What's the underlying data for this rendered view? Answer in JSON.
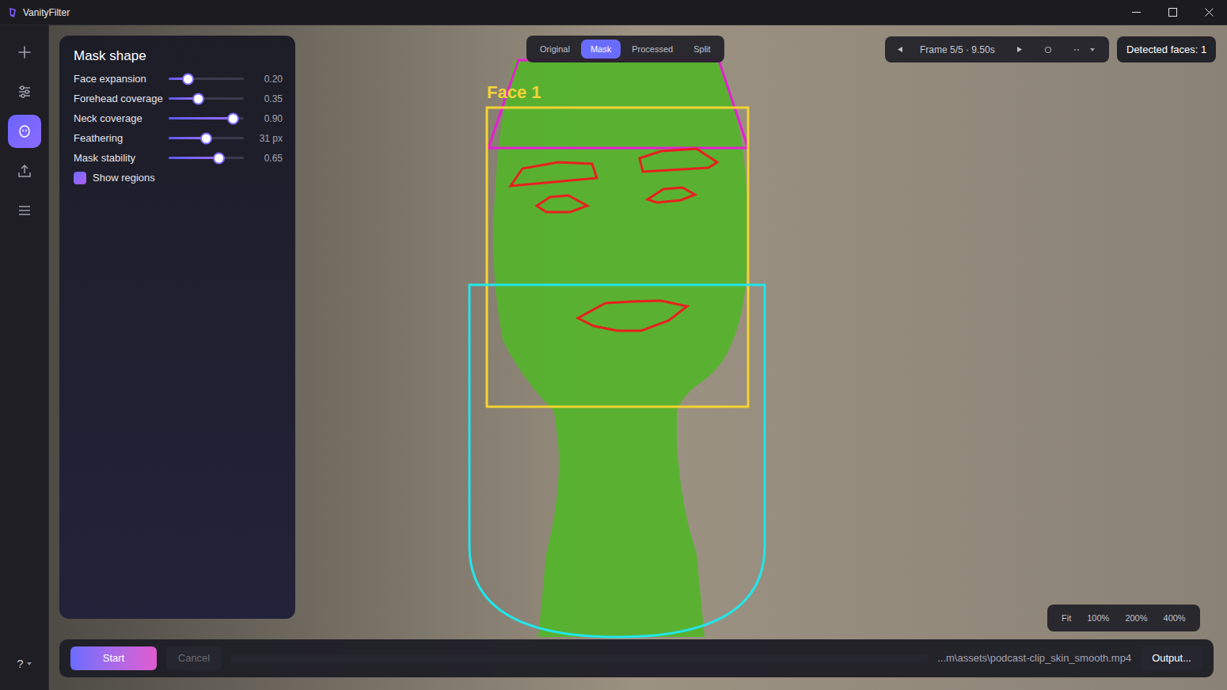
{
  "window": {
    "title": "VanityFilter"
  },
  "rail": {
    "items": [
      {
        "selected": false
      },
      {
        "selected": false
      },
      {
        "selected": true
      },
      {
        "selected": false
      },
      {
        "selected": false
      }
    ],
    "help": "?"
  },
  "panel": {
    "title": "Mask shape",
    "sliders": [
      {
        "label": "Face expansion",
        "level": 0.25,
        "reading": "0.20"
      },
      {
        "label": "Forehead coverage",
        "level": 0.39,
        "reading": "0.35"
      },
      {
        "label": "Neck coverage",
        "level": 0.85,
        "reading": "0.90"
      },
      {
        "label": "Feathering",
        "level": 0.49,
        "reading": "31 px"
      },
      {
        "label": "Mask stability",
        "level": 0.66,
        "reading": "0.65"
      }
    ],
    "show_regions": {
      "label": "Show regions",
      "checked": true
    }
  },
  "view_tabs": [
    {
      "label": "Original",
      "selected": false
    },
    {
      "label": "Mask",
      "selected": true
    },
    {
      "label": "Processed",
      "selected": false
    },
    {
      "label": "Split",
      "selected": false
    }
  ],
  "frame_nav": {
    "label": "Frame 5/5 · 9.50s"
  },
  "detected_faces": "Detected faces: 1",
  "overlay": {
    "faces": [
      {
        "label": "Face 1"
      }
    ],
    "regions": [
      {
        "kind": "forehead",
        "color": "#e61fd4"
      },
      {
        "kind": "face",
        "color": "#f5d332"
      },
      {
        "kind": "neck",
        "color": "#22e6ea"
      },
      {
        "kind": "brow-left",
        "color": "#e8201e"
      },
      {
        "kind": "brow-right",
        "color": "#e8201e"
      },
      {
        "kind": "eye-left",
        "color": "#e8201e"
      },
      {
        "kind": "eye-right",
        "color": "#e8201e"
      },
      {
        "kind": "lips",
        "color": "#e8201e"
      }
    ]
  },
  "zoom": [
    {
      "label": "Fit",
      "selected": false
    },
    {
      "label": "100%",
      "selected": false
    },
    {
      "label": "200%",
      "selected": false
    },
    {
      "label": "400%",
      "selected": false
    }
  ],
  "bottom_bar": {
    "start": "Start",
    "cancel": {
      "label": "Cancel",
      "disabled": true
    },
    "progress": {
      "level": 0
    },
    "output_path": "...m\\assets\\podcast-clip_skin_smooth.mp4",
    "output_button": "Output..."
  }
}
